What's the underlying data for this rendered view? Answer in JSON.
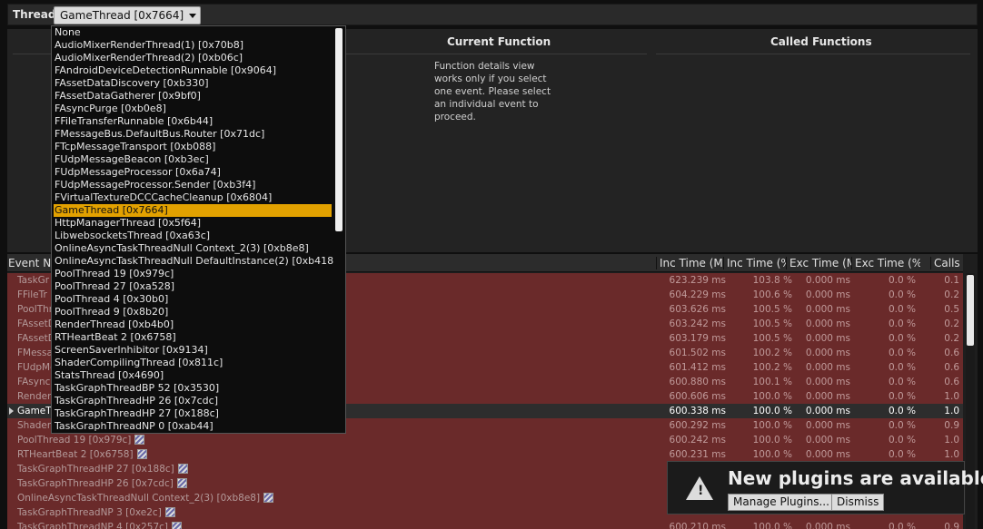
{
  "thread_bar": {
    "label": "Thread",
    "selected": "GameThread [0x7664]"
  },
  "function_panel": {
    "current_function_header": "Current Function",
    "called_functions_header": "Called Functions",
    "message": "Function details view works only if you select one event. Please select an individual event to proceed."
  },
  "table": {
    "headers": [
      "Event Na",
      "Inc Time (MS",
      "Inc Time (%)",
      "Exc Time (MS",
      "Exc Time (%)",
      "Calls"
    ],
    "rows": [
      {
        "name": "TaskGr",
        "stripe": false,
        "inc_ms": "623.239 ms",
        "inc_pct": "103.8 %",
        "exc_ms": "0.000 ms",
        "exc_pct": "0.0 %",
        "calls": "0.1"
      },
      {
        "name": "FFileTr",
        "stripe": false,
        "inc_ms": "604.229 ms",
        "inc_pct": "100.6 %",
        "exc_ms": "0.000 ms",
        "exc_pct": "0.0 %",
        "calls": "0.2"
      },
      {
        "name": "PoolThr",
        "stripe": false,
        "inc_ms": "603.626 ms",
        "inc_pct": "100.5 %",
        "exc_ms": "0.000 ms",
        "exc_pct": "0.0 %",
        "calls": "0.5"
      },
      {
        "name": "FAssetD",
        "stripe": false,
        "inc_ms": "603.242 ms",
        "inc_pct": "100.5 %",
        "exc_ms": "0.000 ms",
        "exc_pct": "0.0 %",
        "calls": "0.2"
      },
      {
        "name": "FAssetD",
        "stripe": false,
        "inc_ms": "603.179 ms",
        "inc_pct": "100.5 %",
        "exc_ms": "0.000 ms",
        "exc_pct": "0.0 %",
        "calls": "0.2"
      },
      {
        "name": "FMessa",
        "stripe": false,
        "inc_ms": "601.502 ms",
        "inc_pct": "100.2 %",
        "exc_ms": "0.000 ms",
        "exc_pct": "0.0 %",
        "calls": "0.6"
      },
      {
        "name": "FUdpMe",
        "stripe": false,
        "inc_ms": "601.412 ms",
        "inc_pct": "100.2 %",
        "exc_ms": "0.000 ms",
        "exc_pct": "0.0 %",
        "calls": "0.6"
      },
      {
        "name": "FAsync",
        "stripe": false,
        "inc_ms": "600.880 ms",
        "inc_pct": "100.1 %",
        "exc_ms": "0.000 ms",
        "exc_pct": "0.0 %",
        "calls": "0.6"
      },
      {
        "name": "RenderT",
        "stripe": false,
        "inc_ms": "600.606 ms",
        "inc_pct": "100.0 %",
        "exc_ms": "0.000 ms",
        "exc_pct": "0.0 %",
        "calls": "1.0"
      },
      {
        "name": "GameTh",
        "stripe": false,
        "selected": true,
        "inc_ms": "600.338 ms",
        "inc_pct": "100.0 %",
        "exc_ms": "0.000 ms",
        "exc_pct": "0.0 %",
        "calls": "1.0"
      },
      {
        "name": "ShaderC",
        "stripe": false,
        "inc_ms": "600.292 ms",
        "inc_pct": "100.0 %",
        "exc_ms": "0.000 ms",
        "exc_pct": "0.0 %",
        "calls": "0.9"
      },
      {
        "name": "PoolThread 19 [0x979c]",
        "stripe": true,
        "inc_ms": "600.242 ms",
        "inc_pct": "100.0 %",
        "exc_ms": "0.000 ms",
        "exc_pct": "0.0 %",
        "calls": "1.0"
      },
      {
        "name": "RTHeartBeat 2 [0x6758]",
        "stripe": true,
        "inc_ms": "600.231 ms",
        "inc_pct": "100.0 %",
        "exc_ms": "0.000 ms",
        "exc_pct": "0.0 %",
        "calls": "1.0"
      },
      {
        "name": "TaskGraphThreadHP 27 [0x188c]",
        "stripe": true,
        "inc_ms": "",
        "inc_pct": "",
        "exc_ms": "",
        "exc_pct": "",
        "calls": ""
      },
      {
        "name": "TaskGraphThreadHP 26 [0x7cdc]",
        "stripe": true,
        "inc_ms": "",
        "inc_pct": "",
        "exc_ms": "",
        "exc_pct": "",
        "calls": ""
      },
      {
        "name": "OnlineAsyncTaskThreadNull Context_2(3) [0xb8e8]",
        "stripe": true,
        "inc_ms": "",
        "inc_pct": "",
        "exc_ms": "",
        "exc_pct": "",
        "calls": ""
      },
      {
        "name": "TaskGraphThreadNP 3 [0xe2c]",
        "stripe": true,
        "inc_ms": "",
        "inc_pct": "",
        "exc_ms": "",
        "exc_pct": "",
        "calls": ""
      },
      {
        "name": "TaskGraphThreadNP 4 [0x257c]",
        "stripe": true,
        "inc_ms": "600.210 ms",
        "inc_pct": "100.0 %",
        "exc_ms": "0.000 ms",
        "exc_pct": "0.0 %",
        "calls": "0.9"
      }
    ]
  },
  "notification": {
    "title": "New plugins are available",
    "manage_button": "Manage Plugins...",
    "dismiss_button": "Dismiss"
  },
  "dropdown": {
    "items": [
      "None",
      "AudioMixerRenderThread(1) [0x70b8]",
      "AudioMixerRenderThread(2) [0xb06c]",
      "FAndroidDeviceDetectionRunnable [0x9064]",
      "FAssetDataDiscovery [0xb330]",
      "FAssetDataGatherer [0x9bf0]",
      "FAsyncPurge [0xb0e8]",
      "FFileTransferRunnable [0x6b44]",
      "FMessageBus.DefaultBus.Router [0x71dc]",
      "FTcpMessageTransport [0xb088]",
      "FUdpMessageBeacon [0xb3ec]",
      "FUdpMessageProcessor [0x6a74]",
      "FUdpMessageProcessor.Sender [0xb3f4]",
      "FVirtualTextureDCCCacheCleanup [0x6804]",
      "GameThread [0x7664]",
      "HttpManagerThread [0x5f64]",
      "LibwebsocketsThread [0xa63c]",
      "OnlineAsyncTaskThreadNull Context_2(3) [0xb8e8]",
      "OnlineAsyncTaskThreadNull DefaultInstance(2) [0xb418]",
      "PoolThread 19 [0x979c]",
      "PoolThread 27 [0xa528]",
      "PoolThread 4 [0x30b0]",
      "PoolThread 9 [0x8b20]",
      "RenderThread [0xb4b0]",
      "RTHeartBeat 2 [0x6758]",
      "ScreenSaverInhibitor [0x9134]",
      "ShaderCompilingThread [0x811c]",
      "StatsThread [0x4690]",
      "TaskGraphThreadBP 52 [0x3530]",
      "TaskGraphThreadHP 26 [0x7cdc]",
      "TaskGraphThreadHP 27 [0x188c]",
      "TaskGraphThreadNP 0 [0xab44]"
    ],
    "selected_index": 14
  }
}
